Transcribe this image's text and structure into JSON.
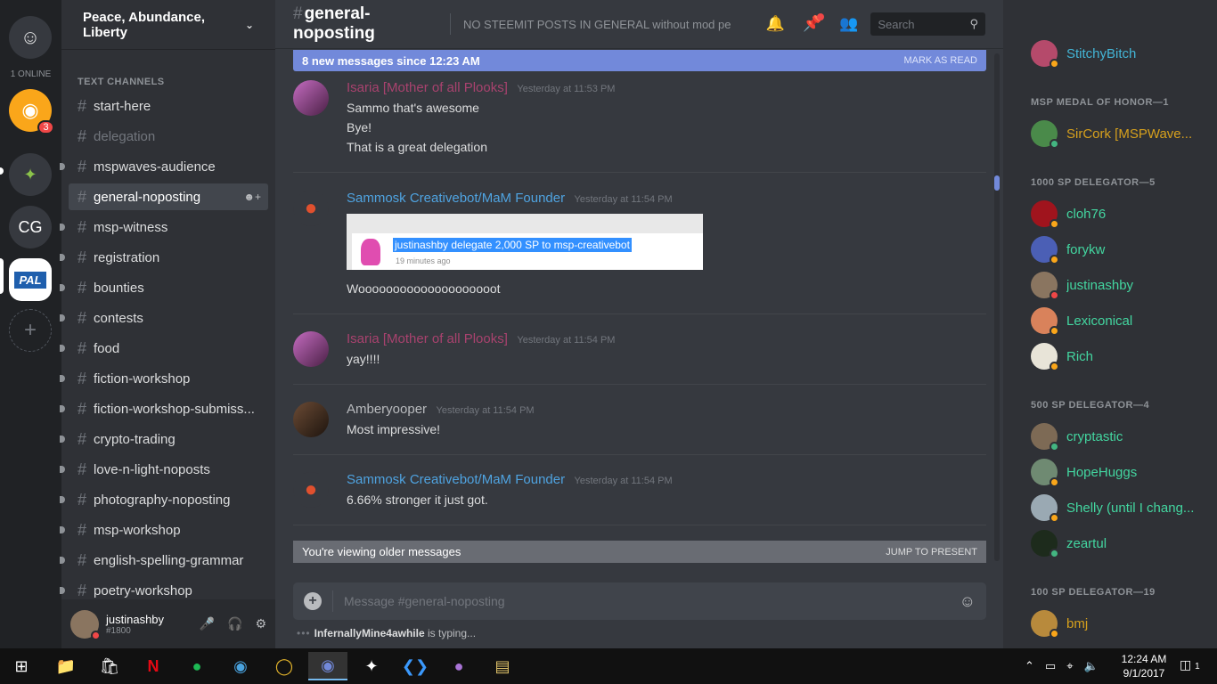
{
  "servers": {
    "online_count": "1 ONLINE",
    "items": [
      {
        "label": "",
        "kind": "friends"
      },
      {
        "label": "",
        "kind": "discord",
        "badge": "3"
      },
      {
        "label": "",
        "kind": "server-bird"
      },
      {
        "label": "CG",
        "kind": "server-text"
      },
      {
        "label": "PAL",
        "kind": "server-pal"
      },
      {
        "label": "+",
        "kind": "add"
      }
    ]
  },
  "guild": {
    "name": "Peace, Abundance, Liberty"
  },
  "channels": {
    "category": "TEXT CHANNELS",
    "items": [
      {
        "name": "start-here"
      },
      {
        "name": "delegation"
      },
      {
        "name": "mspwaves-audience"
      },
      {
        "name": "general-noposting"
      },
      {
        "name": "msp-witness"
      },
      {
        "name": "registration"
      },
      {
        "name": "bounties"
      },
      {
        "name": "contests"
      },
      {
        "name": "food"
      },
      {
        "name": "fiction-workshop"
      },
      {
        "name": "fiction-workshop-submiss..."
      },
      {
        "name": "crypto-trading"
      },
      {
        "name": "love-n-light-noposts"
      },
      {
        "name": "photography-noposting"
      },
      {
        "name": "msp-workshop"
      },
      {
        "name": "english-spelling-grammar"
      },
      {
        "name": "poetry-workshop"
      }
    ]
  },
  "user": {
    "name": "justinashby",
    "tag": "#1800"
  },
  "header": {
    "channel": "general-noposting",
    "topic": "NO STEEMIT POSTS IN GENERAL without mod perm...",
    "search_placeholder": "Search"
  },
  "new_bar": {
    "text": "8 new messages since 12:23 AM",
    "action": "MARK AS READ"
  },
  "messages": [
    {
      "author": "Isaria [Mother of all Plooks]",
      "ts": "Yesterday at 11:53 PM",
      "color": "#a8426e",
      "lines": [
        "Sammo that's awesome",
        "Bye!",
        "That is a great delegation"
      ]
    },
    {
      "author": "Sammosk Creativebot/MaM Founder",
      "ts": "Yesterday at 11:54 PM",
      "color": "#4fa3e0",
      "lines": [
        "Woooooooooooooooooooot"
      ]
    },
    {
      "author": "Isaria [Mother of all Plooks]",
      "ts": "Yesterday at 11:54 PM",
      "color": "#a8426e",
      "lines": [
        "yay!!!!"
      ]
    },
    {
      "author": "Amberyooper",
      "ts": "Yesterday at 11:54 PM",
      "color": "#b9bbbe",
      "lines": [
        "Most impressive!"
      ]
    },
    {
      "author": "Sammosk Creativebot/MaM Founder",
      "ts": "Yesterday at 11:54 PM",
      "color": "#4fa3e0",
      "lines": [
        "6.66% stronger it just got."
      ]
    }
  ],
  "embed": {
    "highlight": "justinashby delegate 2,000 SP to msp-creativebot",
    "ago": "19 minutes ago"
  },
  "older_bar": {
    "text": "You're viewing older messages",
    "action": "JUMP TO PRESENT"
  },
  "composer": {
    "placeholder": "Message #general-noposting"
  },
  "typing": {
    "user": "InfernallyMine4awhile",
    "text": "is typing..."
  },
  "members": {
    "top": {
      "name": "StitchyBitch",
      "color": "#43b5d6"
    },
    "roles": [
      {
        "title": "MSP MEDAL OF HONOR—1",
        "members": [
          {
            "name": "SirCork [MSPWave...",
            "color": "#d6a01d",
            "status": "online"
          }
        ]
      },
      {
        "title": "1000 SP DELEGATOR—5",
        "members": [
          {
            "name": "cloh76",
            "color": "#43d6a0",
            "status": "idle"
          },
          {
            "name": "forykw",
            "color": "#43d6a0",
            "status": "idle"
          },
          {
            "name": "justinashby",
            "color": "#43d6a0",
            "status": "dnd"
          },
          {
            "name": "Lexiconical",
            "color": "#43d6a0",
            "status": "idle"
          },
          {
            "name": "Rich",
            "color": "#43d6a0",
            "status": "idle"
          }
        ]
      },
      {
        "title": "500 SP DELEGATOR—4",
        "members": [
          {
            "name": "cryptastic",
            "color": "#43d6a0",
            "status": "online"
          },
          {
            "name": "HopeHuggs",
            "color": "#43d6a0",
            "status": "idle"
          },
          {
            "name": "Shelly (until I chang...",
            "color": "#43d6a0",
            "status": "idle"
          },
          {
            "name": "zeartul",
            "color": "#43d6a0",
            "status": "online"
          }
        ]
      },
      {
        "title": "100 SP DELEGATOR—19",
        "members": [
          {
            "name": "bmj",
            "color": "#d6a01d",
            "status": "idle"
          }
        ]
      }
    ]
  },
  "taskbar": {
    "time": "12:24 AM",
    "date": "9/1/2017",
    "notif_count": "1"
  },
  "colors": {
    "online": "#43b581",
    "idle": "#faa61a",
    "dnd": "#f04747",
    "accent": "#7289da"
  }
}
